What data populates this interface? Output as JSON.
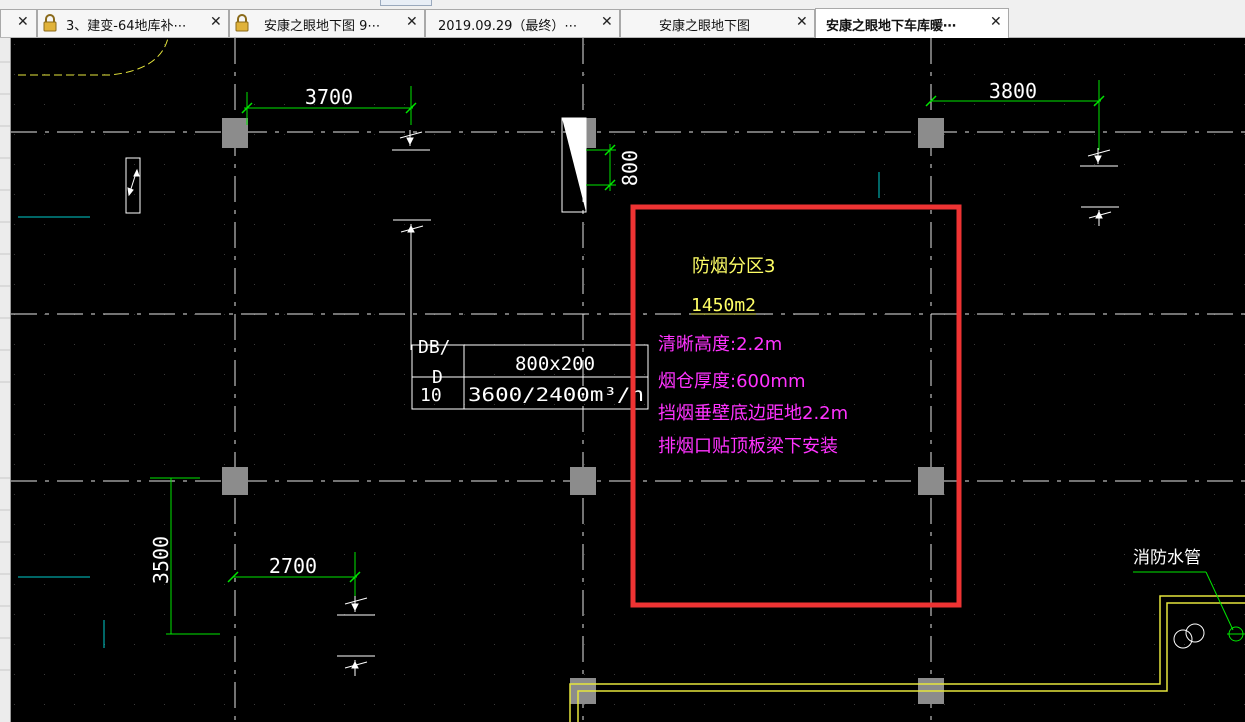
{
  "tabs": [
    {
      "label": "",
      "locked": false,
      "active": false
    },
    {
      "label": "3、建变-64地库补⋯",
      "locked": true,
      "active": false
    },
    {
      "label": "安康之眼地下图 9⋯",
      "locked": true,
      "active": false
    },
    {
      "label": "2019.09.29（最终）⋯",
      "locked": false,
      "active": false
    },
    {
      "label": "安康之眼地下图",
      "locked": false,
      "active": false
    },
    {
      "label": "安康之眼地下车库暖⋯",
      "locked": false,
      "active": true
    }
  ],
  "close_glyph": "✕",
  "drawing": {
    "dimensions": {
      "top_left": "3700",
      "top_right": "3800",
      "vertical_duct": "800",
      "left_vertical": "3500",
      "bottom_left": "2700"
    },
    "duct_table": {
      "row1_left": "DB/",
      "row1_left2": "D",
      "row1_right": "800x200",
      "row2_left": "10",
      "row2_right": "3600/2400m³/h"
    },
    "smoke_zone": {
      "title": "防烟分区3",
      "area": "1450m2",
      "line1": "清晰高度:2.2m",
      "line2": "烟仓厚度:600mm",
      "line3": "挡烟垂壁底边距地2.2m",
      "line4": "排烟口贴顶板梁下安装"
    },
    "fire_pipe_label": "消防水管",
    "colors": {
      "background": "#000000",
      "grid_line": "#ffffff",
      "dimension": "#00e600",
      "yellow_text": "#ffff66",
      "magenta_text": "#ff33ff",
      "highlight_box": "#ee3333",
      "column": "#8c8c8c",
      "wall": "#e6e63c",
      "cyan_mark": "#00cccc"
    }
  }
}
